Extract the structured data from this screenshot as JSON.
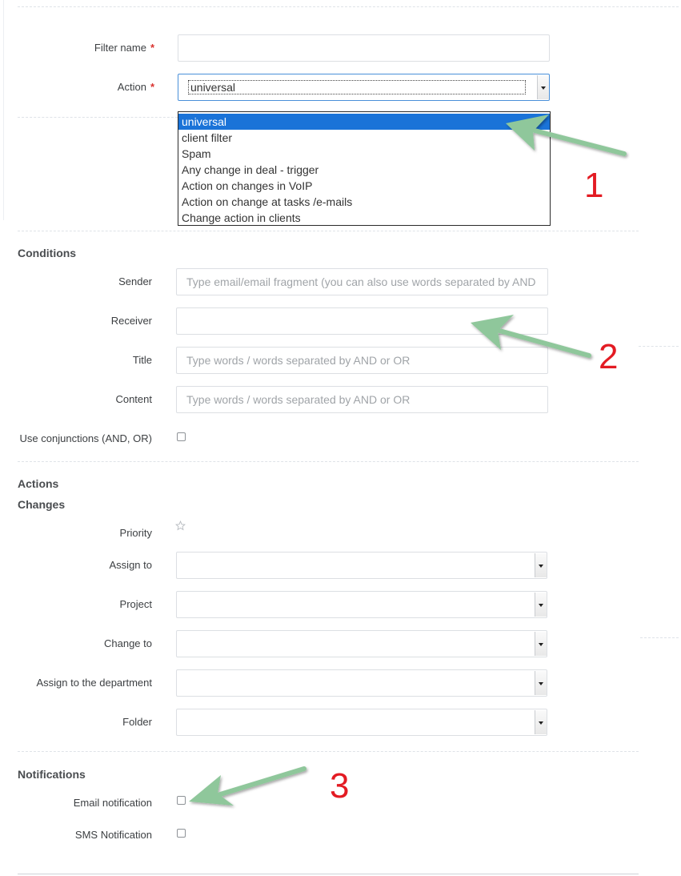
{
  "filter": {
    "filter_name_label": "Filter name",
    "action_label": "Action",
    "required_mark": "*",
    "action_value": "universal",
    "action_options": [
      "universal",
      "client filter",
      "Spam",
      "Any change in deal - trigger",
      "Action on changes in VoIP",
      "Action on change at tasks /e-mails",
      "Change action in clients"
    ]
  },
  "conditions": {
    "title": "Conditions",
    "sender_label": "Sender",
    "sender_placeholder": "Type email/email fragment (you can also use words separated by AND",
    "receiver_label": "Receiver",
    "title_label": "Title",
    "title_placeholder": "Type words / words separated by AND or OR",
    "content_label": "Content",
    "content_placeholder": "Type words / words separated by AND or OR",
    "conjunctions_label": "Use conjunctions (AND, OR)"
  },
  "actions": {
    "title": "Actions",
    "changes_title": "Changes",
    "priority_label": "Priority",
    "assign_to_label": "Assign to",
    "project_label": "Project",
    "change_to_label": "Change to",
    "assign_department_label": "Assign to the department",
    "folder_label": "Folder"
  },
  "notifications": {
    "title": "Notifications",
    "email_label": "Email notification",
    "sms_label": "SMS Notification"
  },
  "annotations": {
    "arrow_color": "#8fc79b",
    "number_color": "#e31b23",
    "marker_1": "1",
    "marker_2": "2",
    "marker_3": "3"
  }
}
